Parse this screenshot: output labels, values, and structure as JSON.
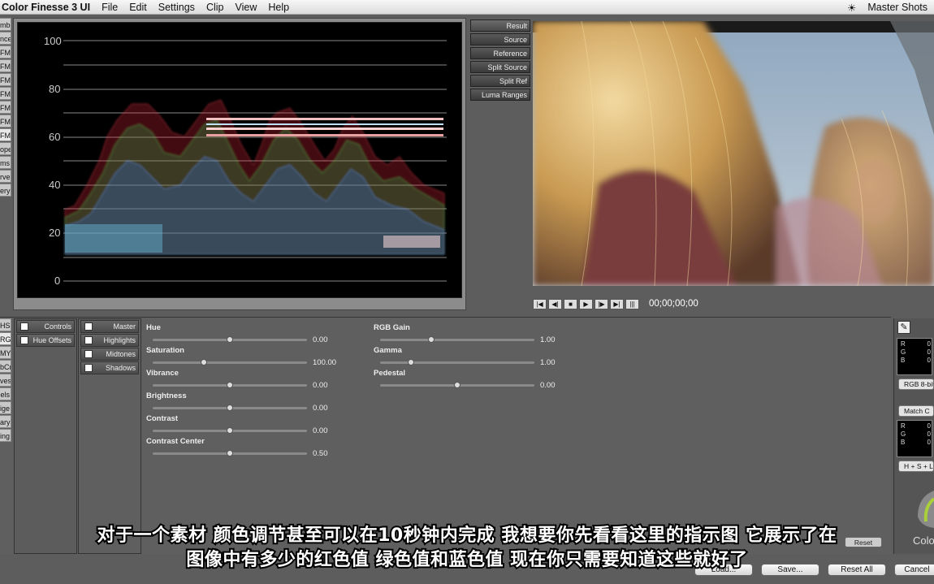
{
  "menubar": {
    "app_title": "Color Finesse 3 UI",
    "items": [
      "File",
      "Edit",
      "Settings",
      "Clip",
      "View",
      "Help"
    ],
    "workspace": "Master Shots",
    "status_icon": "sun-icon"
  },
  "left_tabs_top": [
    "mbo",
    "nce",
    "FM",
    "FM",
    "FM",
    "FM",
    "FM",
    "FM",
    "FM",
    "ope",
    "ms",
    "rve",
    "ery"
  ],
  "scope": {
    "type": "parade-waveform",
    "tick_labels": [
      "100",
      "80",
      "60",
      "40",
      "20",
      "0"
    ]
  },
  "view_tabs": [
    "Result",
    "Source",
    "Reference",
    "Split Source",
    "Split Ref",
    "Luma Ranges"
  ],
  "transport": {
    "timecode": "00;00;00;00",
    "buttons": [
      "first-frame-icon",
      "step-back-icon",
      "stop-icon",
      "play-icon",
      "step-forward-icon",
      "last-frame-icon",
      "loop-icon"
    ]
  },
  "left_tabs_bottom": [
    "HSL",
    "RGB",
    "MY",
    "bCr",
    "ves",
    "els",
    "ige",
    "ary",
    "ing"
  ],
  "controls": {
    "items": [
      "Controls",
      "Hue Offsets"
    ]
  },
  "ranges": {
    "items": [
      "Master",
      "Highlights",
      "Midtones",
      "Shadows"
    ]
  },
  "sliders_left": [
    {
      "label": "Hue",
      "value": "0.00",
      "pos": 0.5
    },
    {
      "label": "Saturation",
      "value": "100.00",
      "pos": 0.33
    },
    {
      "label": "Vibrance",
      "value": "0.00",
      "pos": 0.5
    },
    {
      "label": "Brightness",
      "value": "0.00",
      "pos": 0.5
    },
    {
      "label": "Contrast",
      "value": "0.00",
      "pos": 0.5
    },
    {
      "label": "Contrast Center",
      "value": "0.50",
      "pos": 0.5
    }
  ],
  "sliders_right": [
    {
      "label": "RGB Gain",
      "value": "1.00",
      "pos": 0.33
    },
    {
      "label": "Gamma",
      "value": "1.00",
      "pos": 0.2
    },
    {
      "label": "Pedestal",
      "value": "0.00",
      "pos": 0.5
    }
  ],
  "right_panel": {
    "eyedropper": "eyedropper-icon",
    "readout1": [
      "R",
      "G",
      "B"
    ],
    "readout1_vals": [
      "0",
      "0",
      "0"
    ],
    "mode_button": "RGB 8-bit",
    "match_button": "Match C",
    "readout2": [
      "R",
      "G",
      "B"
    ],
    "readout2_vals": [
      "0",
      "0",
      "0"
    ],
    "hsl_button": "H + S + L",
    "logo_text": "Color F"
  },
  "buttons": {
    "reset": "Reset",
    "load": "Load...",
    "save": "Save...",
    "reset_all": "Reset All",
    "cancel": "Cancel"
  },
  "subtitles": [
    "对于一个素材 颜色调节甚至可以在10秒钟内完成 我想要你先看看这里的指示图 它展示了在",
    "图像中有多少的红色值 绿色值和蓝色值  现在你只需要知道这些就好了"
  ]
}
